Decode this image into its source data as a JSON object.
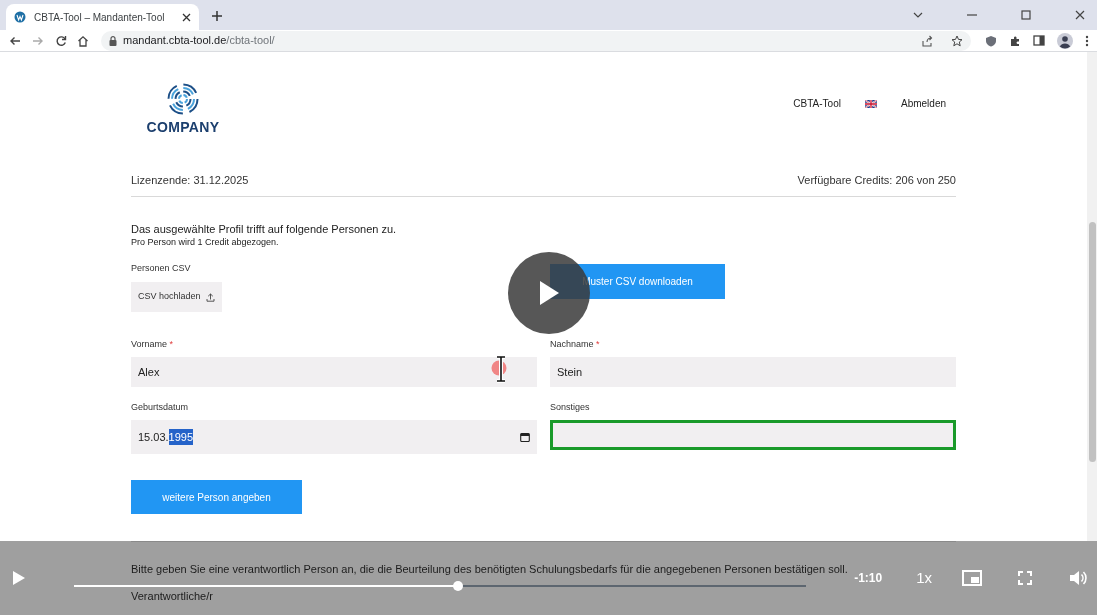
{
  "browser": {
    "tab": {
      "title": "CBTA-Tool – Mandanten-Tool",
      "selected": true
    },
    "url": {
      "host": "mandant.cbta-tool.de",
      "path": "/cbta-tool/"
    }
  },
  "page": {
    "logo_text": "COMPANY",
    "nav": [
      {
        "kind": "link",
        "label": "CBTA-Tool"
      },
      {
        "kind": "flag"
      },
      {
        "kind": "link",
        "label": "Abmelden"
      }
    ],
    "license": "Lizenzende: 31.12.2025",
    "credits": "Verfügbare Credits: 206 von 250",
    "intro": "Das ausgewählte Profil trifft auf folgende Personen zu.",
    "note": "Pro Person wird 1 Credit abgezogen.",
    "csv_label": "Personen CSV",
    "csv_upload": "CSV hochladen",
    "csv_template": "Muster CSV downloaden",
    "fields": [
      {
        "kind": "text",
        "label": "Vorname",
        "required_mark": "*",
        "value_parts": [
          {
            "text": "Alex",
            "selected": false
          }
        ],
        "focused": false
      },
      {
        "kind": "text",
        "label": "Nachname",
        "required_mark": "*",
        "value_parts": [
          {
            "text": "Stein",
            "selected": false
          }
        ],
        "focused": false
      },
      {
        "kind": "date",
        "label": "Geburtsdatum",
        "value_parts": [
          {
            "text": "15.03.",
            "selected": false
          },
          {
            "text": "1995",
            "selected": true
          }
        ],
        "focused": false
      },
      {
        "kind": "text",
        "label": "Sonstiges",
        "focused": true
      }
    ],
    "add_person": "weitere Person angeben",
    "responsible_text": "Bitte geben Sie eine verantwortlich Person an, die die Beurteilung des benötigten Schulungsbedarfs für die angegebenen Personen bestätigen soll.",
    "responsible_heading": "Verantwortliche/r"
  },
  "player": {
    "playing": false,
    "level": 0.525,
    "time": "-1:10",
    "speed": "1x"
  }
}
